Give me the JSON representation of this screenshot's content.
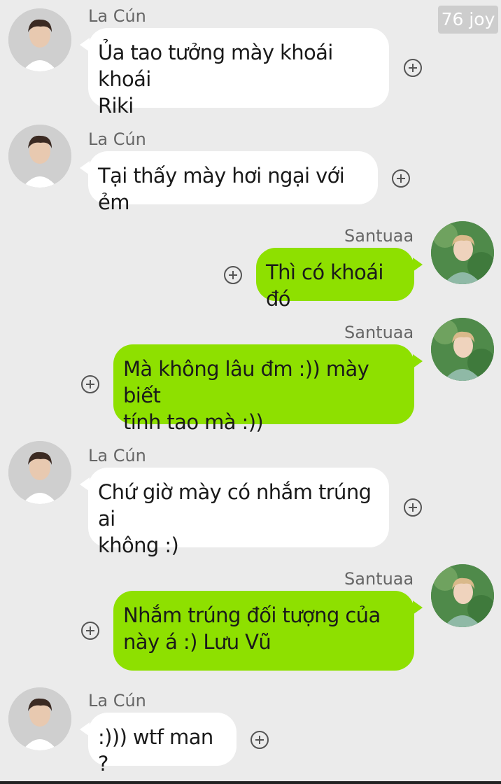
{
  "watermark": "76 joy",
  "messages": [
    {
      "sender": "La Cún",
      "side": "left",
      "lines": [
        "Ủa tao tưởng mày khoái khoái",
        "Riki"
      ]
    },
    {
      "sender": "La Cún",
      "side": "left",
      "lines": [
        "Tại thấy mày hơi ngại với ẻm"
      ]
    },
    {
      "sender": "Santuaa",
      "side": "right",
      "lines": [
        "Thì có khoái đó"
      ]
    },
    {
      "sender": "Santuaa",
      "side": "right",
      "lines": [
        "Mà không lâu đm :)) mày biết",
        "tính tao mà :))"
      ]
    },
    {
      "sender": "La Cún",
      "side": "left",
      "lines": [
        "Chứ giờ mày có nhắm trúng ai",
        "không :)"
      ]
    },
    {
      "sender": "Santuaa",
      "side": "right",
      "lines": [
        "Nhắm trúng đối tượng của",
        "này á :) Lưu Vũ"
      ]
    },
    {
      "sender": "La Cún",
      "side": "left",
      "lines": [
        ":))) wtf man ?"
      ]
    }
  ],
  "colors": {
    "background": "#ebebeb",
    "incoming_bubble": "#ffffff",
    "outgoing_bubble": "#8ee000"
  },
  "icons": {
    "add": "plus-circle-icon"
  }
}
